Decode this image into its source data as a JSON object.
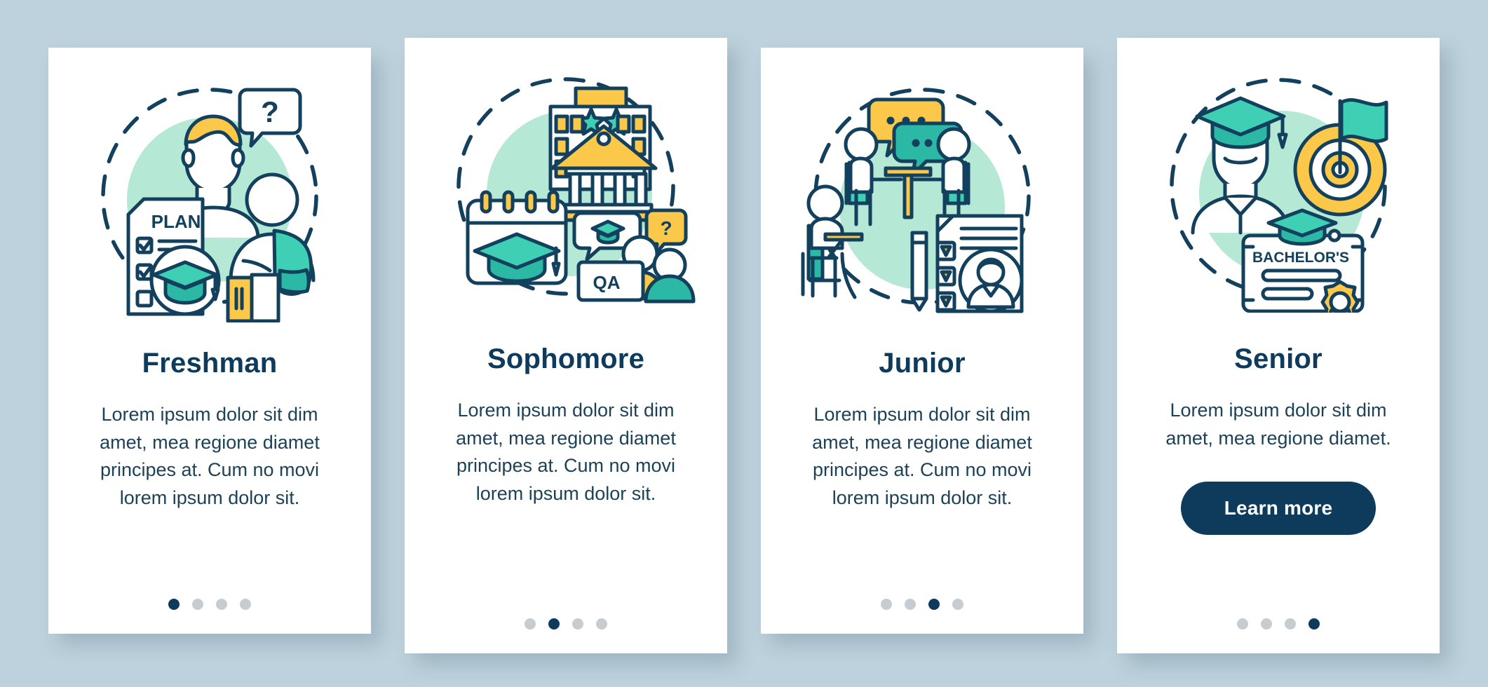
{
  "background_color": "#bdd2dc",
  "palette": {
    "title": "#0e3a5c",
    "body": "#1d4258",
    "button_bg": "#0e3a5c",
    "button_text": "#ffffff",
    "dot_active": "#0e3a5c",
    "dot_inactive": "#c7ccd0",
    "card_bg": "#ffffff",
    "mint_circle": "#b6e8d6",
    "teal": "#3fcfb5",
    "yellow": "#fbc84a",
    "outline": "#13405c"
  },
  "cards": [
    {
      "id": "freshman",
      "title": "Freshman",
      "body": "Lorem ipsum dolor sit dim amet, mea regione diamet principes at. Cum no movi lorem ipsum dolor sit.",
      "illustration_label": "freshman-illustration",
      "illustration_text": {
        "plan": "PLAN"
      },
      "dots": {
        "count": 4,
        "active_index": 0
      },
      "has_cta": false
    },
    {
      "id": "sophomore",
      "title": "Sophomore",
      "body": "Lorem ipsum dolor sit dim amet, mea regione diamet principes at. Cum no movi lorem ipsum dolor sit.",
      "illustration_label": "sophomore-illustration",
      "illustration_text": {
        "qa": "QA",
        "question": "?"
      },
      "dots": {
        "count": 4,
        "active_index": 1
      },
      "has_cta": false
    },
    {
      "id": "junior",
      "title": "Junior",
      "body": "Lorem ipsum dolor sit dim amet, mea regione diamet principes at. Cum no movi lorem ipsum dolor sit.",
      "illustration_label": "junior-illustration",
      "illustration_text": {},
      "dots": {
        "count": 4,
        "active_index": 2
      },
      "has_cta": false
    },
    {
      "id": "senior",
      "title": "Senior",
      "body": "Lorem ipsum dolor sit dim amet, mea regione diamet.",
      "illustration_label": "senior-illustration",
      "illustration_text": {
        "bachelors": "BACHELOR'S"
      },
      "dots": {
        "count": 4,
        "active_index": 3
      },
      "has_cta": true,
      "cta_label": "Learn more"
    }
  ]
}
